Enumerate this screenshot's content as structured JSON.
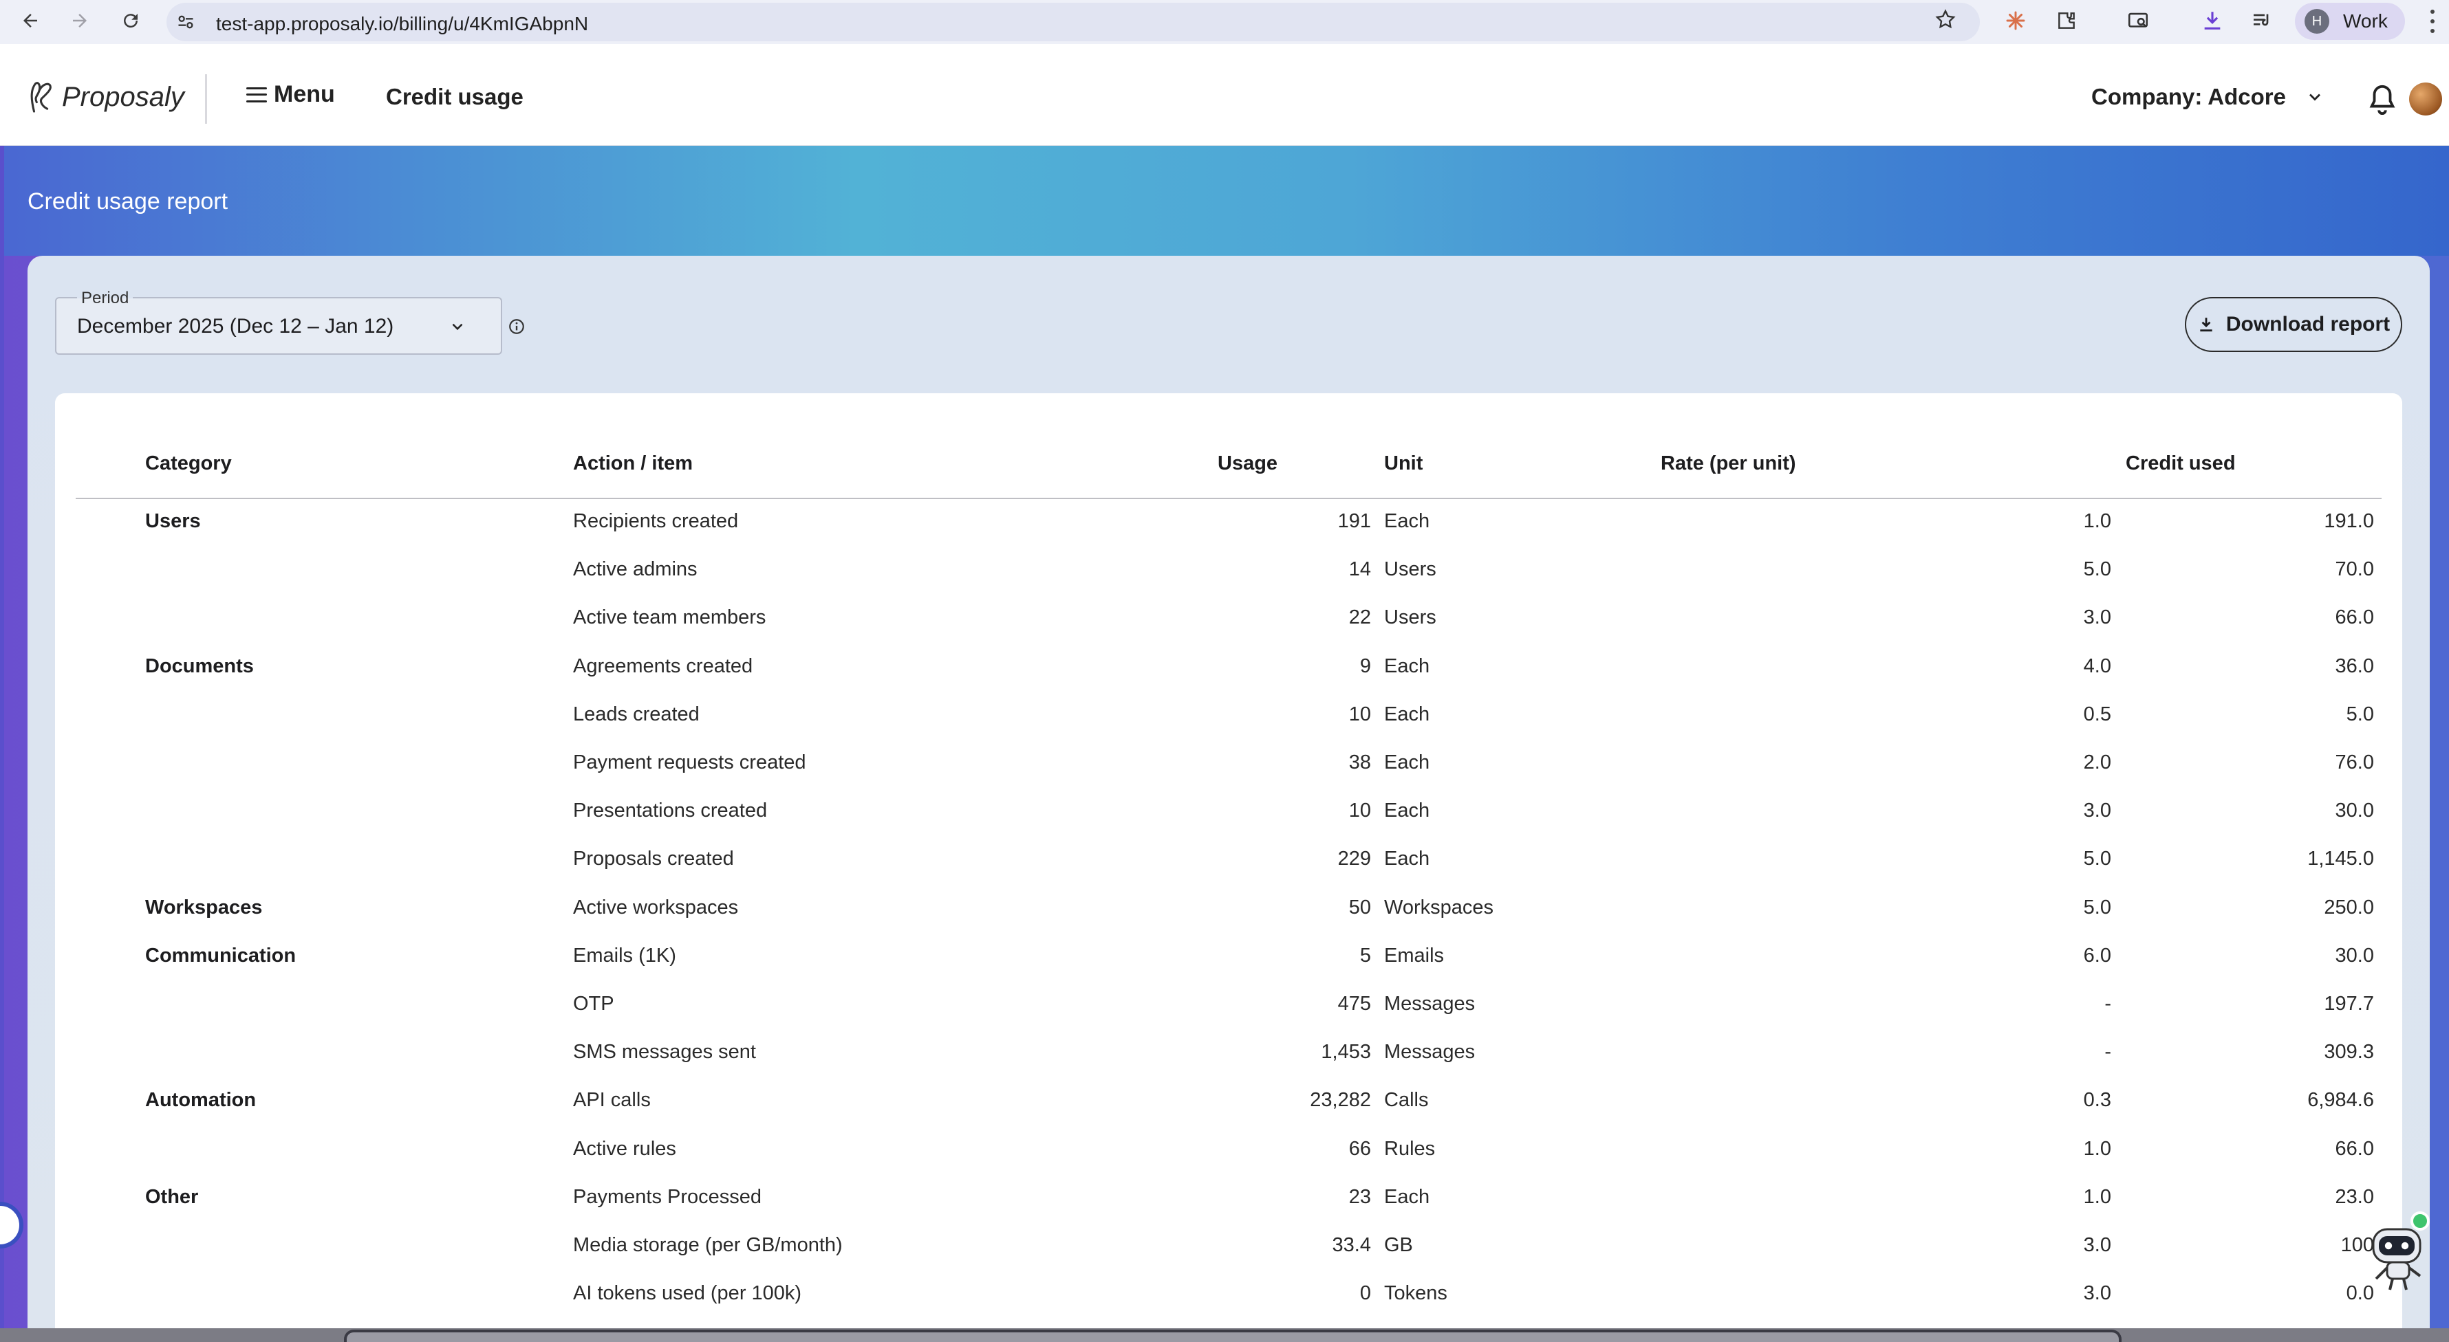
{
  "browser": {
    "url": "test-app.proposaly.io/billing/u/4KmIGAbpnN",
    "profile_initial": "H",
    "profile_label": "Work"
  },
  "header": {
    "logo_text": "Proposaly",
    "menu_label": "Menu",
    "crumb": "Credit usage",
    "company_label": "Company: Adcore"
  },
  "page": {
    "title": "Credit usage report",
    "period_label": "Period",
    "period_value": "December 2025 (Dec 12 – Jan 12)",
    "download_label": "Download report"
  },
  "table": {
    "headers": {
      "category": "Category",
      "action": "Action / item",
      "usage": "Usage",
      "unit": "Unit",
      "rate": "Rate (per unit)",
      "credit": "Credit used"
    },
    "rows": [
      {
        "category": "Users",
        "action": "Recipients created",
        "usage": "191",
        "unit": "Each",
        "rate": "1.0",
        "credit": "191.0"
      },
      {
        "category": "",
        "action": "Active admins",
        "usage": "14",
        "unit": "Users",
        "rate": "5.0",
        "credit": "70.0"
      },
      {
        "category": "",
        "action": "Active team members",
        "usage": "22",
        "unit": "Users",
        "rate": "3.0",
        "credit": "66.0"
      },
      {
        "category": "Documents",
        "action": "Agreements created",
        "usage": "9",
        "unit": "Each",
        "rate": "4.0",
        "credit": "36.0"
      },
      {
        "category": "",
        "action": "Leads created",
        "usage": "10",
        "unit": "Each",
        "rate": "0.5",
        "credit": "5.0"
      },
      {
        "category": "",
        "action": "Payment requests created",
        "usage": "38",
        "unit": "Each",
        "rate": "2.0",
        "credit": "76.0"
      },
      {
        "category": "",
        "action": "Presentations created",
        "usage": "10",
        "unit": "Each",
        "rate": "3.0",
        "credit": "30.0"
      },
      {
        "category": "",
        "action": "Proposals created",
        "usage": "229",
        "unit": "Each",
        "rate": "5.0",
        "credit": "1,145.0"
      },
      {
        "category": "Workspaces",
        "action": "Active workspaces",
        "usage": "50",
        "unit": "Workspaces",
        "rate": "5.0",
        "credit": "250.0"
      },
      {
        "category": "Communication",
        "action": "Emails (1K)",
        "usage": "5",
        "unit": "Emails",
        "rate": "6.0",
        "credit": "30.0"
      },
      {
        "category": "",
        "action": "OTP",
        "usage": "475",
        "unit": "Messages",
        "rate": "-",
        "credit": "197.7"
      },
      {
        "category": "",
        "action": "SMS messages sent",
        "usage": "1,453",
        "unit": "Messages",
        "rate": "-",
        "credit": "309.3"
      },
      {
        "category": "Automation",
        "action": "API calls",
        "usage": "23,282",
        "unit": "Calls",
        "rate": "0.3",
        "credit": "6,984.6"
      },
      {
        "category": "",
        "action": "Active rules",
        "usage": "66",
        "unit": "Rules",
        "rate": "1.0",
        "credit": "66.0"
      },
      {
        "category": "Other",
        "action": "Payments Processed",
        "usage": "23",
        "unit": "Each",
        "rate": "1.0",
        "credit": "23.0"
      },
      {
        "category": "",
        "action": "Media storage (per GB/month)",
        "usage": "33.4",
        "unit": "GB",
        "rate": "3.0",
        "credit": "100"
      },
      {
        "category": "",
        "action": "AI tokens used (per 100k)",
        "usage": "0",
        "unit": "Tokens",
        "rate": "3.0",
        "credit": "0.0"
      }
    ]
  }
}
